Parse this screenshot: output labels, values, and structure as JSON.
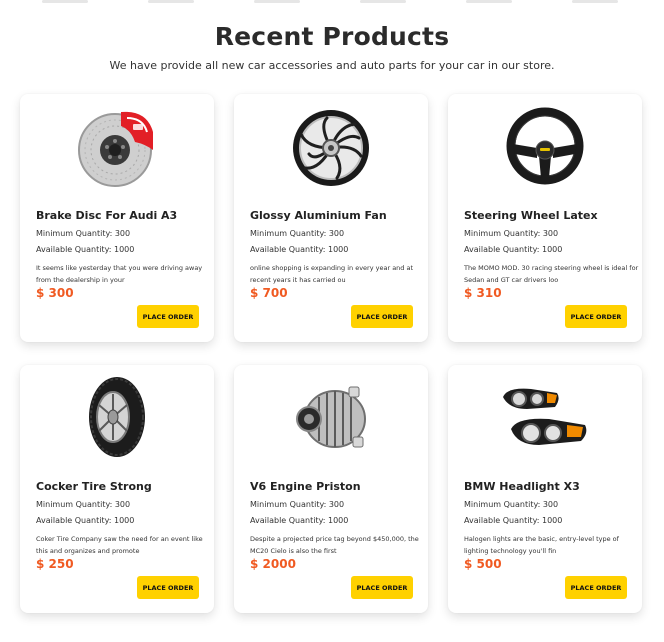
{
  "header": {
    "title": "Recent Products",
    "subtitle": "We have provide all new car accessories and auto parts for your car in our store."
  },
  "colors": {
    "price": "#f05a22",
    "button": "#ffd100"
  },
  "products": [
    {
      "name": "Brake Disc For Audi A3",
      "min_qty": "Minimum Quantity: 300",
      "avail_qty": "Available Quantity: 1000",
      "desc": "It seems like yesterday that you were driving away from the dealership in your",
      "price": "$ 300",
      "button": "PLACE ORDER",
      "icon": "brake-disc-icon"
    },
    {
      "name": "Glossy Aluminium Fan",
      "min_qty": "Minimum Quantity: 300",
      "avail_qty": "Available Quantity: 1000",
      "desc": "online shopping is expanding in every year and at recent years it has carried ou",
      "price": "$ 700",
      "button": "PLACE ORDER",
      "icon": "alloy-wheel-icon"
    },
    {
      "name": "Steering Wheel Latex",
      "min_qty": "Minimum Quantity: 300",
      "avail_qty": "Available Quantity: 1000",
      "desc": "The MOMO MOD. 30 racing steering wheel is ideal for Sedan and GT car drivers loo",
      "price": "$ 310",
      "button": "PLACE ORDER",
      "icon": "steering-wheel-icon"
    },
    {
      "name": "Cocker Tire Strong",
      "min_qty": "Minimum Quantity: 300",
      "avail_qty": "Available Quantity: 1000",
      "desc": "Coker Tire Company saw the need for an event like this and organizes and promote",
      "price": "$ 250",
      "button": "PLACE ORDER",
      "icon": "tire-icon"
    },
    {
      "name": "V6 Engine Priston",
      "min_qty": "Minimum Quantity: 300",
      "avail_qty": "Available Quantity: 1000",
      "desc": "Despite a projected price tag beyond $450,000, the MC20 Cielo is also the first",
      "price": "$ 2000",
      "button": "PLACE ORDER",
      "icon": "alternator-icon"
    },
    {
      "name": "BMW Headlight X3",
      "min_qty": "Minimum Quantity: 300",
      "avail_qty": "Available Quantity: 1000",
      "desc": "Halogen lights are the basic, entry-level type of lighting technology you'll fin",
      "price": "$ 500",
      "button": "PLACE ORDER",
      "icon": "headlight-icon"
    }
  ]
}
